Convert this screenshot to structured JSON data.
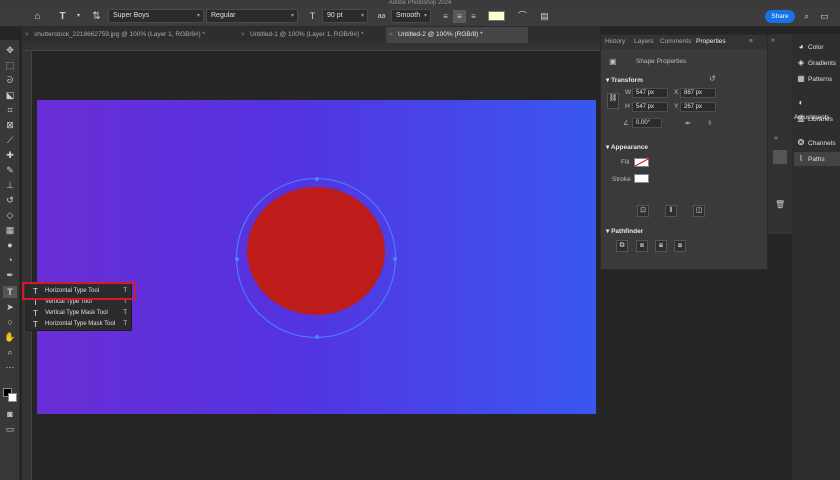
{
  "app": {
    "title": "Adobe Photoshop 2024"
  },
  "options_bar": {
    "font_family": "Super Boys",
    "font_style": "Regular",
    "font_size": "90 pt",
    "antialias": "Smooth",
    "share_label": "Share",
    "text_color": "#ffffcc"
  },
  "tabs": [
    {
      "label": "shutterstock_2218662759.jpg @ 100% (Layer 1, RGB/8#) *",
      "active": false
    },
    {
      "label": "Untitled-1 @ 100% (Layer 1, RGB/8#) *",
      "active": false
    },
    {
      "label": "Untitled-2 @ 100% (RGB/8) *",
      "active": true
    }
  ],
  "flyout": {
    "items": [
      {
        "label": "Horizontal Type Tool",
        "shortcut": "T",
        "icon": "T",
        "selected": true
      },
      {
        "label": "Vertical Type Tool",
        "shortcut": "T",
        "icon": "↓T",
        "selected": false
      },
      {
        "label": "Vertical Type Mask Tool",
        "shortcut": "T",
        "icon": "↓T",
        "selected": false
      },
      {
        "label": "Horizontal Type Mask Tool",
        "shortcut": "T",
        "icon": "T",
        "selected": false
      }
    ]
  },
  "panel": {
    "tabs": [
      "History",
      "Layers",
      "Comments",
      "Properties"
    ],
    "active_tab": "Properties",
    "shape_properties": "Shape Properties",
    "transform": {
      "title": "Transform",
      "w_label": "W",
      "w": "547 px",
      "h_label": "H",
      "h": "547 px",
      "x_label": "X",
      "x": "887 px",
      "y_label": "Y",
      "y": "267 px",
      "angle": "0.00°"
    },
    "appearance": {
      "title": "Appearance",
      "fill_label": "Fill",
      "stroke_label": "Stroke"
    },
    "pathfinder": {
      "title": "Pathfinder"
    }
  },
  "right_panel": {
    "items": [
      {
        "label": "Color",
        "icon": "color-icon"
      },
      {
        "label": "Gradients",
        "icon": "gradients-icon"
      },
      {
        "label": "Patterns",
        "icon": "patterns-icon"
      },
      {
        "label": "Adjustments",
        "icon": "adjustments-icon"
      },
      {
        "label": "Libraries",
        "icon": "libraries-icon"
      },
      {
        "label": "Channels",
        "icon": "channels-icon"
      },
      {
        "label": "Paths",
        "icon": "paths-icon"
      }
    ]
  },
  "colors": {
    "canvas_gradient_start": "#6a2ed6",
    "canvas_gradient_end": "#3a57f0",
    "circle_fill": "#be1b1b",
    "highlight": "#d6192a",
    "accent": "#1473e6"
  }
}
